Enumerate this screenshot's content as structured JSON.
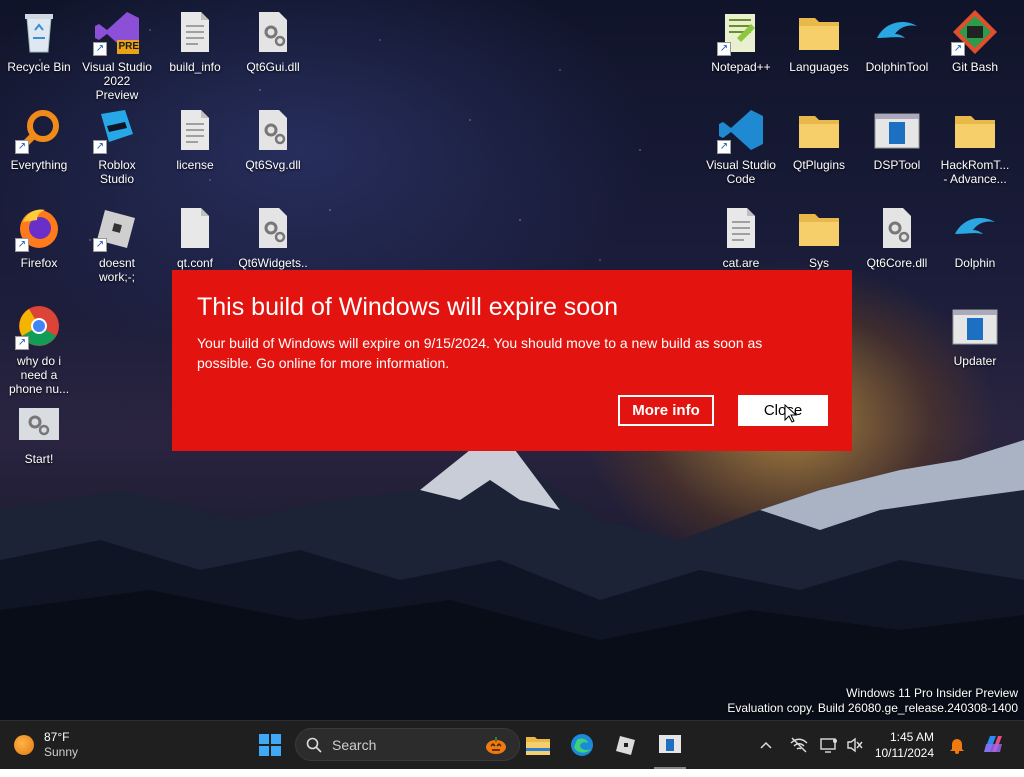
{
  "desktop": {
    "icons": [
      {
        "label": "Recycle Bin"
      },
      {
        "label": "Visual Studio 2022 Preview",
        "badge": "PRE"
      },
      {
        "label": "build_info"
      },
      {
        "label": "Qt6Gui.dll"
      },
      {
        "label": "Everything"
      },
      {
        "label": "Roblox Studio"
      },
      {
        "label": "license"
      },
      {
        "label": "Qt6Svg.dll"
      },
      {
        "label": "Firefox"
      },
      {
        "label": "doesnt work;-;"
      },
      {
        "label": "qt.conf"
      },
      {
        "label": "Qt6Widgets..."
      },
      {
        "label": "why do i need a phone nu..."
      },
      {
        "label": "Start!"
      },
      {
        "label": "Notepad++"
      },
      {
        "label": "Languages"
      },
      {
        "label": "DolphinTool"
      },
      {
        "label": "Git Bash"
      },
      {
        "label": "Visual Studio Code"
      },
      {
        "label": "QtPlugins"
      },
      {
        "label": "DSPTool"
      },
      {
        "label": "HackRomT... - Advance..."
      },
      {
        "label": "cat.are"
      },
      {
        "label": "Sys"
      },
      {
        "label": "Qt6Core.dll"
      },
      {
        "label": "Dolphin"
      },
      {
        "label": "Updater"
      }
    ]
  },
  "dialog": {
    "title": "This build of Windows will expire soon",
    "message": "Your build of Windows will expire on 9/15/2024. You should move to a new build as soon as possible. Go online for more information.",
    "more_info_label": "More info",
    "close_label": "Close",
    "background_color": "#e3140f"
  },
  "watermark": {
    "line1": "Windows 11 Pro Insider Preview",
    "line2": "Evaluation copy. Build 26080.ge_release.240308-1400"
  },
  "taskbar": {
    "weather": {
      "temp": "87°F",
      "condition": "Sunny",
      "icon": "sun-icon"
    },
    "search_placeholder": "Search",
    "pinned": [
      "start-icon",
      "file-explorer-icon",
      "edge-icon",
      "roblox-icon",
      "dsptool-icon"
    ],
    "tray_icons": [
      "chevron-up-icon",
      "network-off-icon",
      "display-icon",
      "volume-muted-icon",
      "bell-icon",
      "copilot-icon"
    ],
    "clock": {
      "time": "1:45 AM",
      "date": "10/11/2024"
    }
  }
}
